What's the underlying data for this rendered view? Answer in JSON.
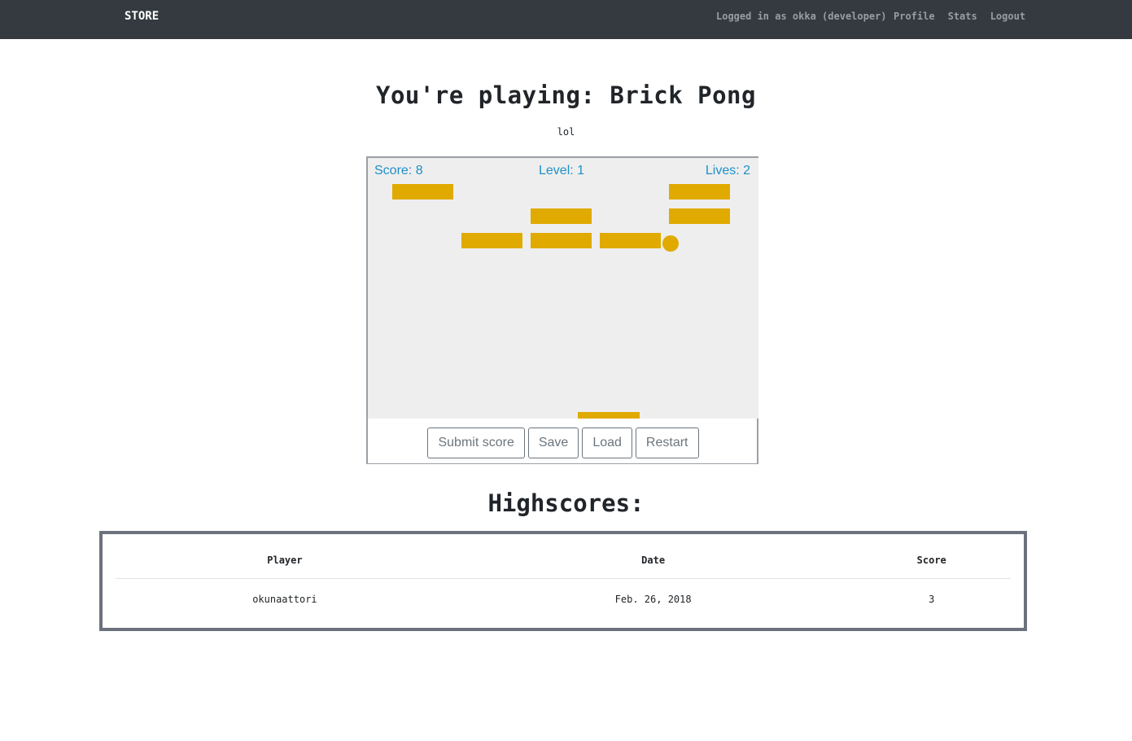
{
  "nav": {
    "brand": "STORE",
    "status": "Logged in as okka (developer)",
    "links": [
      "Profile",
      "Stats",
      "Logout"
    ]
  },
  "page": {
    "title": "You're playing: Brick Pong",
    "subtitle": "lol"
  },
  "game": {
    "score_label": "Score: 8",
    "level_label": "Level: 1",
    "lives_label": "Lives: 2",
    "brick_color": "#e0aa00",
    "canvas_color": "#eeeeee",
    "hud_color": "#1e90c8",
    "buttons": [
      "Submit score",
      "Save",
      "Load",
      "Restart"
    ]
  },
  "highscores": {
    "title": "Highscores:",
    "columns": [
      "Player",
      "Date",
      "Score"
    ],
    "rows": [
      [
        "okunaattori",
        "Feb. 26, 2018",
        "3"
      ]
    ]
  }
}
